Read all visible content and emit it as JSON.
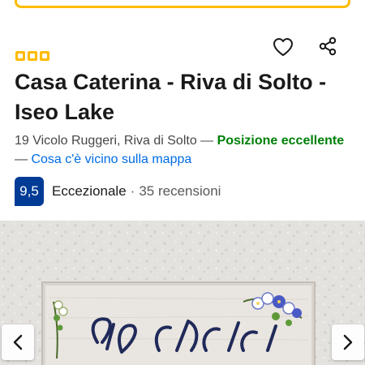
{
  "property": {
    "star_rating": 3,
    "title": "Casa Caterina - Riva di Solto - Iseo Lake",
    "address": "19 Vicolo Ruggeri, Riva di Solto",
    "separator": "—",
    "location_highlight": "Posizione eccellente",
    "map_link": "Cosa c'è vicino sulla mappa",
    "review_score": "9,5",
    "review_word": "Eccezionale",
    "review_dot": "·",
    "review_count": "35 recensioni"
  },
  "icons": {
    "favorite": "heart-outline-icon",
    "share": "share-icon",
    "prev": "chevron-left-icon",
    "next": "chevron-right-icon"
  },
  "colors": {
    "brand_yellow": "#febb02",
    "score_blue": "#003b95",
    "location_green": "#008009",
    "link_blue": "#006ce4"
  }
}
